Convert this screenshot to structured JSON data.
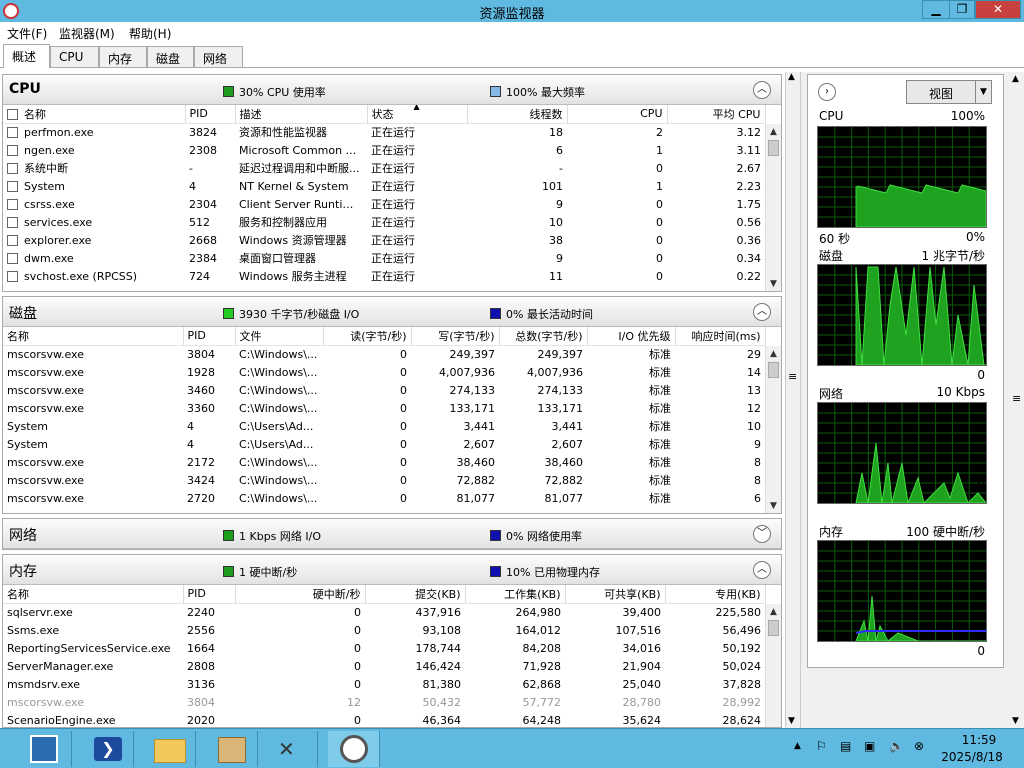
{
  "window": {
    "title": "资源监视器",
    "min": "▁",
    "max": "❐",
    "close": "✕"
  },
  "menu": [
    "文件(F)",
    "监视器(M)",
    "帮助(H)"
  ],
  "tabs": [
    "概述",
    "CPU",
    "内存",
    "磁盘",
    "网络"
  ],
  "cpu": {
    "title": "CPU",
    "legend1": "30% CPU 使用率",
    "legend2": "100% 最大频率",
    "legend1_color": "#1c9e1c",
    "legend2_color": "#86b9e8",
    "headers": [
      "名称",
      "PID",
      "描述",
      "状态",
      "线程数",
      "CPU",
      "平均 CPU"
    ],
    "rows": [
      [
        "perfmon.exe",
        "3824",
        "资源和性能监视器",
        "正在运行",
        "18",
        "2",
        "3.12"
      ],
      [
        "ngen.exe",
        "2308",
        "Microsoft Common ...",
        "正在运行",
        "6",
        "1",
        "3.11"
      ],
      [
        "系统中断",
        "-",
        "延迟过程调用和中断服...",
        "正在运行",
        "-",
        "0",
        "2.67"
      ],
      [
        "System",
        "4",
        "NT Kernel & System",
        "正在运行",
        "101",
        "1",
        "2.23"
      ],
      [
        "csrss.exe",
        "2304",
        "Client Server Runtim...",
        "正在运行",
        "9",
        "0",
        "1.75"
      ],
      [
        "services.exe",
        "512",
        "服务和控制器应用",
        "正在运行",
        "10",
        "0",
        "0.56"
      ],
      [
        "explorer.exe",
        "2668",
        "Windows 资源管理器",
        "正在运行",
        "38",
        "0",
        "0.36"
      ],
      [
        "dwm.exe",
        "2384",
        "桌面窗口管理器",
        "正在运行",
        "9",
        "0",
        "0.34"
      ],
      [
        "svchost.exe (RPCSS)",
        "724",
        "Windows 服务主进程",
        "正在运行",
        "11",
        "0",
        "0.22"
      ]
    ]
  },
  "disk": {
    "title": "磁盘",
    "legend1": "3930 千字节/秒磁盘 I/O",
    "legend2": "0% 最长活动时间",
    "legend1_color": "#22cc22",
    "legend2_color": "#1010b0",
    "headers": [
      "名称",
      "PID",
      "文件",
      "读(字节/秒)",
      "写(字节/秒)",
      "总数(字节/秒)",
      "I/O 优先级",
      "响应时间(ms)"
    ],
    "rows": [
      [
        "mscorsvw.exe",
        "3804",
        "C:\\Windows\\...",
        "0",
        "249,397",
        "249,397",
        "标准",
        "29"
      ],
      [
        "mscorsvw.exe",
        "1928",
        "C:\\Windows\\...",
        "0",
        "4,007,936",
        "4,007,936",
        "标准",
        "14"
      ],
      [
        "mscorsvw.exe",
        "3460",
        "C:\\Windows\\...",
        "0",
        "274,133",
        "274,133",
        "标准",
        "13"
      ],
      [
        "mscorsvw.exe",
        "3360",
        "C:\\Windows\\...",
        "0",
        "133,171",
        "133,171",
        "标准",
        "12"
      ],
      [
        "System",
        "4",
        "C:\\Users\\Ad...",
        "0",
        "3,441",
        "3,441",
        "标准",
        "10"
      ],
      [
        "System",
        "4",
        "C:\\Users\\Ad...",
        "0",
        "2,607",
        "2,607",
        "标准",
        "9"
      ],
      [
        "mscorsvw.exe",
        "2172",
        "C:\\Windows\\...",
        "0",
        "38,460",
        "38,460",
        "标准",
        "8"
      ],
      [
        "mscorsvw.exe",
        "3424",
        "C:\\Windows\\...",
        "0",
        "72,882",
        "72,882",
        "标准",
        "8"
      ],
      [
        "mscorsvw.exe",
        "2720",
        "C:\\Windows\\...",
        "0",
        "81,077",
        "81,077",
        "标准",
        "6"
      ]
    ]
  },
  "network": {
    "title": "网络",
    "legend1": "1 Kbps 网络 I/O",
    "legend2": "0% 网络使用率",
    "legend1_color": "#1c9e1c",
    "legend2_color": "#1010b0"
  },
  "memory": {
    "title": "内存",
    "legend1": "1 硬中断/秒",
    "legend2": "10% 已用物理内存",
    "legend1_color": "#1c9e1c",
    "legend2_color": "#1010b0",
    "headers": [
      "名称",
      "PID",
      "硬中断/秒",
      "提交(KB)",
      "工作集(KB)",
      "可共享(KB)",
      "专用(KB)"
    ],
    "rows": [
      [
        "sqlservr.exe",
        "2240",
        "0",
        "437,916",
        "264,980",
        "39,400",
        "225,580"
      ],
      [
        "Ssms.exe",
        "2556",
        "0",
        "93,108",
        "164,012",
        "107,516",
        "56,496"
      ],
      [
        "ReportingServicesService.exe",
        "1664",
        "0",
        "178,744",
        "84,208",
        "34,016",
        "50,192"
      ],
      [
        "ServerManager.exe",
        "2808",
        "0",
        "146,424",
        "71,928",
        "21,904",
        "50,024"
      ],
      [
        "msmdsrv.exe",
        "3136",
        "0",
        "81,380",
        "62,868",
        "25,040",
        "37,828"
      ],
      [
        "mscorsvw.exe",
        "3804",
        "12",
        "50,432",
        "57,772",
        "28,780",
        "28,992"
      ],
      [
        "ScenarioEngine.exe",
        "2020",
        "0",
        "46,364",
        "64,248",
        "35,624",
        "28,624"
      ]
    ]
  },
  "right": {
    "view_label": "视图",
    "graphs": [
      {
        "name": "CPU",
        "scale": "100%",
        "left_bottom": "60 秒",
        "right_bottom": "0%"
      },
      {
        "name": "磁盘",
        "scale": "1 兆字节/秒",
        "left_bottom": "",
        "right_bottom": "0"
      },
      {
        "name": "网络",
        "scale": "10 Kbps",
        "left_bottom": "",
        "right_bottom": "0"
      },
      {
        "name": "内存",
        "scale": "100 硬中断/秒",
        "left_bottom": "",
        "right_bottom": "0"
      }
    ]
  },
  "taskbar": {
    "time": "11:59",
    "date": "2025/8/18",
    "apps": [
      "server-manager-icon",
      "powershell-icon",
      "file-explorer-icon",
      "package-icon",
      "tools-icon",
      "resource-monitor-icon"
    ]
  }
}
